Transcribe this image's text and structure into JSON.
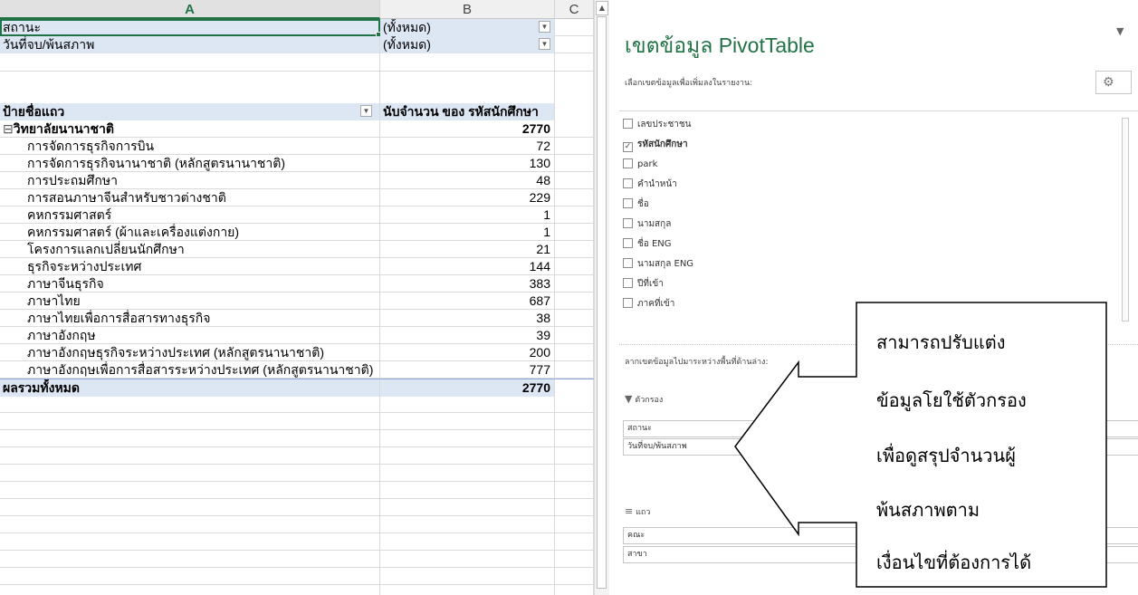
{
  "sheet": {
    "columns": [
      "A",
      "B",
      "C"
    ],
    "filters": [
      {
        "label": "สถานะ",
        "value": "(ทั้งหมด)"
      },
      {
        "label": "วันที่จบ/พ้นสภาพ",
        "value": "(ทั้งหมด)"
      }
    ],
    "row_label_header": "ป้ายชื่อแถว",
    "value_header": "นับจำนวน ของ รหัสนักศึกษา",
    "group": {
      "name": "วิทยาลัยนานาชาติ",
      "total": "2770",
      "collapse_icon": "minus-box-icon"
    },
    "rows": [
      {
        "name": "การจัดการธุรกิจการบิน",
        "count": "72"
      },
      {
        "name": "การจัดการธุรกิจนานาชาติ (หลักสูตรนานาชาติ)",
        "count": "130"
      },
      {
        "name": "การประถมศึกษา",
        "count": "48"
      },
      {
        "name": "การสอนภาษาจีนสำหรับชาวต่างชาติ",
        "count": "229"
      },
      {
        "name": "คหกรรมศาสตร์",
        "count": "1"
      },
      {
        "name": "คหกรรมศาสตร์ (ผ้าและเครื่องแต่งกาย)",
        "count": "1"
      },
      {
        "name": "โครงการแลกเปลี่ยนนักศึกษา",
        "count": "21"
      },
      {
        "name": "ธุรกิจระหว่างประเทศ",
        "count": "144"
      },
      {
        "name": "ภาษาจีนธุรกิจ",
        "count": "383"
      },
      {
        "name": "ภาษาไทย",
        "count": "687"
      },
      {
        "name": "ภาษาไทยเพื่อการสื่อสารทางธุรกิจ",
        "count": "38"
      },
      {
        "name": "ภาษาอังกฤษ",
        "count": "39"
      },
      {
        "name": "ภาษาอังกฤษธุรกิจระหว่างประเทศ (หลักสูตรนานาชาติ)",
        "count": "200"
      },
      {
        "name": "ภาษาอังกฤษเพื่อการสื่อสารระหว่างประเทศ (หลักสูตรนานาชาติ)",
        "count": "777"
      }
    ],
    "grand_total": {
      "label": "ผลรวมทั้งหมด",
      "value": "2770"
    },
    "accent": "#217346",
    "highlight": "#dde6f3"
  },
  "pane": {
    "title": "เขตข้อมูล PivotTable",
    "subtitle": "เลือกเขตข้อมูลเพื่อเพิ่มลงในรายงาน:",
    "fields": [
      {
        "label": "เลขประชาชน",
        "checked": false
      },
      {
        "label": "รหัสนักศึกษา",
        "checked": true
      },
      {
        "label": "park",
        "checked": false
      },
      {
        "label": "คำนำหน้า",
        "checked": false
      },
      {
        "label": "ชื่อ",
        "checked": false
      },
      {
        "label": "นามสกุล",
        "checked": false
      },
      {
        "label": "ชื่อ ENG",
        "checked": false
      },
      {
        "label": "นามสกุล ENG",
        "checked": false
      },
      {
        "label": "ปีที่เข้า",
        "checked": false
      },
      {
        "label": "ภาคที่เข้า",
        "checked": false
      }
    ],
    "drag_text": "ลากเขตข้อมูลไปมาระหว่างพื้นที่ด้านล่าง:",
    "filters_header": "ตัวกรอง",
    "filter_items": [
      "สถานะ",
      "วันที่จบ/พ้นสภาพ"
    ],
    "rows_header": "แถว",
    "row_items": [
      "คณะ",
      "สาขา"
    ]
  },
  "callout": {
    "lines": [
      "สามารถปรับแต่ง",
      "ข้อมูลโยใช้ตัวกรอง",
      "เพื่อดูสรุปจำนวนผู้",
      "พ้นสภาพตาม",
      "เงื่อนไขที่ต้องการได้"
    ]
  }
}
